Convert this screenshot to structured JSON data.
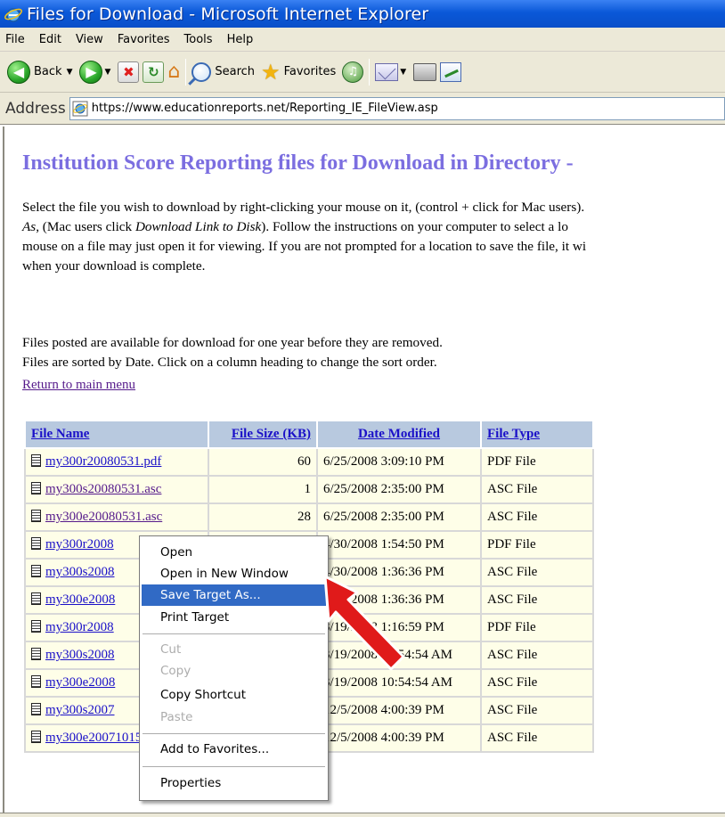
{
  "window": {
    "title": "Files for Download - Microsoft Internet Explorer"
  },
  "menubar": {
    "items": [
      "File",
      "Edit",
      "View",
      "Favorites",
      "Tools",
      "Help"
    ]
  },
  "toolbar": {
    "back_label": "Back",
    "search_label": "Search",
    "favorites_label": "Favorites",
    "icons": [
      "back-icon",
      "forward-icon",
      "stop-icon",
      "refresh-icon",
      "home-icon",
      "search-icon",
      "favorites-icon",
      "media-icon",
      "mail-icon",
      "print-icon",
      "edit-icon"
    ]
  },
  "address": {
    "label": "Address",
    "url": "https://www.educationreports.net/Reporting_IE_FileView.asp"
  },
  "page": {
    "heading": "Institution Score Reporting files for Download in Directory -",
    "para1_line1": "Select the file you wish to download by right-clicking your mouse on it, (control + click for Mac users).",
    "para1_line2_em1": "As",
    "para1_line2_mid": ", (Mac users click ",
    "para1_line2_em2": "Download Link to Disk",
    "para1_line2_end": "). Follow the instructions on your computer to select a lo",
    "para1_line3": "mouse on a file may just open it for viewing. If you are not prompted for a location to save the file, it wi",
    "para1_line4": "when your download is complete.",
    "para2": "Files posted are available for download for one year before they are removed.",
    "para3": "Files are sorted by Date. Click on a column heading to change the sort order.",
    "return_link": "Return to main menu"
  },
  "table": {
    "headers": [
      "File Name",
      "File Size (KB)",
      "Date Modified",
      "File Type"
    ],
    "rows": [
      {
        "name": "my300r20080531.pdf",
        "size": "60",
        "date": "6/25/2008 3:09:10 PM",
        "type": "PDF File",
        "visited": false
      },
      {
        "name": "my300s20080531.asc",
        "size": "1",
        "date": "6/25/2008 2:35:00 PM",
        "type": "ASC File",
        "visited": true
      },
      {
        "name": "my300e20080531.asc",
        "size": "28",
        "date": "6/25/2008 2:35:00 PM",
        "type": "ASC File",
        "visited": true
      },
      {
        "name": "my300r2008",
        "size": "",
        "date": "4/30/2008 1:54:50 PM",
        "type": "PDF File",
        "visited": false
      },
      {
        "name": "my300s2008",
        "size": "",
        "date": "4/30/2008 1:36:36 PM",
        "type": "ASC File",
        "visited": false
      },
      {
        "name": "my300e2008",
        "size": "",
        "date": "4/30/2008 1:36:36 PM",
        "type": "ASC File",
        "visited": false
      },
      {
        "name": "my300r2008",
        "size": "",
        "date": "3/19/2008 1:16:59 PM",
        "type": "PDF File",
        "visited": false
      },
      {
        "name": "my300s2008",
        "size": "",
        "date": "3/19/2008 10:54:54 AM",
        "type": "ASC File",
        "visited": false
      },
      {
        "name": "my300e2008",
        "size": "",
        "date": "3/19/2008 10:54:54 AM",
        "type": "ASC File",
        "visited": false
      },
      {
        "name": "my300s2007",
        "size": "",
        "date": "12/5/2008 4:00:39 PM",
        "type": "ASC File",
        "visited": false
      },
      {
        "name": "my300e20071015.asc",
        "size": "",
        "date": "12/5/2008 4:00:39 PM",
        "type": "ASC File",
        "visited": false
      }
    ]
  },
  "context_menu": {
    "items": [
      {
        "label": "Open",
        "disabled": false,
        "selected": false
      },
      {
        "label": "Open in New Window",
        "disabled": false,
        "selected": false
      },
      {
        "label": "Save Target As...",
        "disabled": false,
        "selected": true
      },
      {
        "label": "Print Target",
        "disabled": false,
        "selected": false
      },
      {
        "label": "Cut",
        "disabled": true,
        "selected": false
      },
      {
        "label": "Copy",
        "disabled": true,
        "selected": false
      },
      {
        "label": "Copy Shortcut",
        "disabled": false,
        "selected": false
      },
      {
        "label": "Paste",
        "disabled": true,
        "selected": false
      },
      {
        "label": "Add to Favorites...",
        "disabled": false,
        "selected": false
      },
      {
        "label": "Properties",
        "disabled": false,
        "selected": false
      }
    ]
  },
  "colors": {
    "title_bar": "#0a58d8",
    "heading": "#7b6ee0",
    "link": "#1a10c8",
    "visited_link": "#551a8b",
    "menu_highlight": "#316ac5",
    "arrow": "#e01a1a"
  }
}
